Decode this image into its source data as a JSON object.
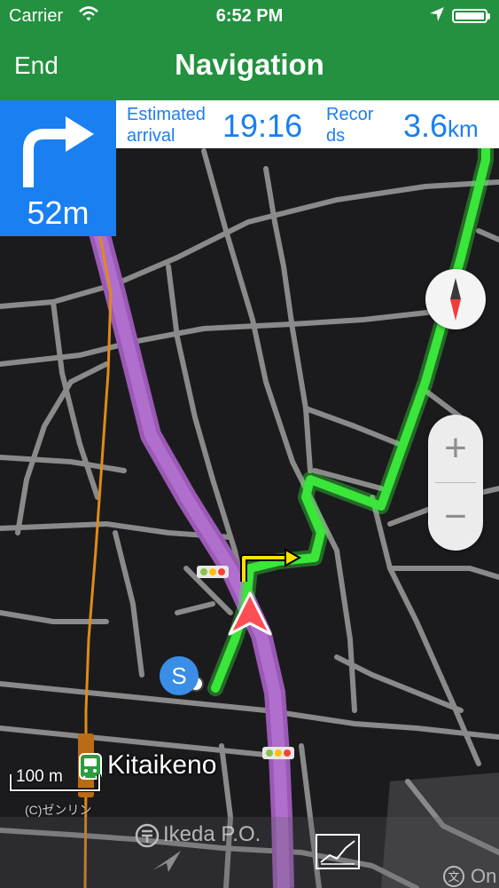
{
  "status_bar": {
    "carrier": "Carrier",
    "time": "6:52 PM",
    "wifi_icon": "wifi-icon",
    "location_icon": "location-arrow-icon",
    "battery_icon": "battery-icon"
  },
  "nav_bar": {
    "end_label": "End",
    "title": "Navigation"
  },
  "turn_instruction": {
    "icon": "turn-right-arrow-icon",
    "distance": "52m"
  },
  "info_bar": {
    "eta_label": "Estimated arrival",
    "eta_value": "19:16",
    "records_label": "Records",
    "records_value": "3.6",
    "records_unit": "km"
  },
  "controls": {
    "compass_icon": "compass-icon",
    "zoom_in": "+",
    "zoom_out": "−"
  },
  "map": {
    "start_marker": "S",
    "station_name": "Kitaikeno",
    "scale": "100 m",
    "copyright": "(C)ゼンリン",
    "poi_name": "Ikeda P.O.",
    "poi_name_2": "On",
    "poi_icon_2": "文",
    "colors": {
      "route": "#39e639",
      "highway": "#9b59b6",
      "railway": "#e08a1a",
      "current_position": "#ff4d55",
      "header": "#23913f",
      "turn_panel": "#1a7ff0"
    }
  },
  "bottom_bar": {
    "chart_icon": "line-chart-icon"
  }
}
